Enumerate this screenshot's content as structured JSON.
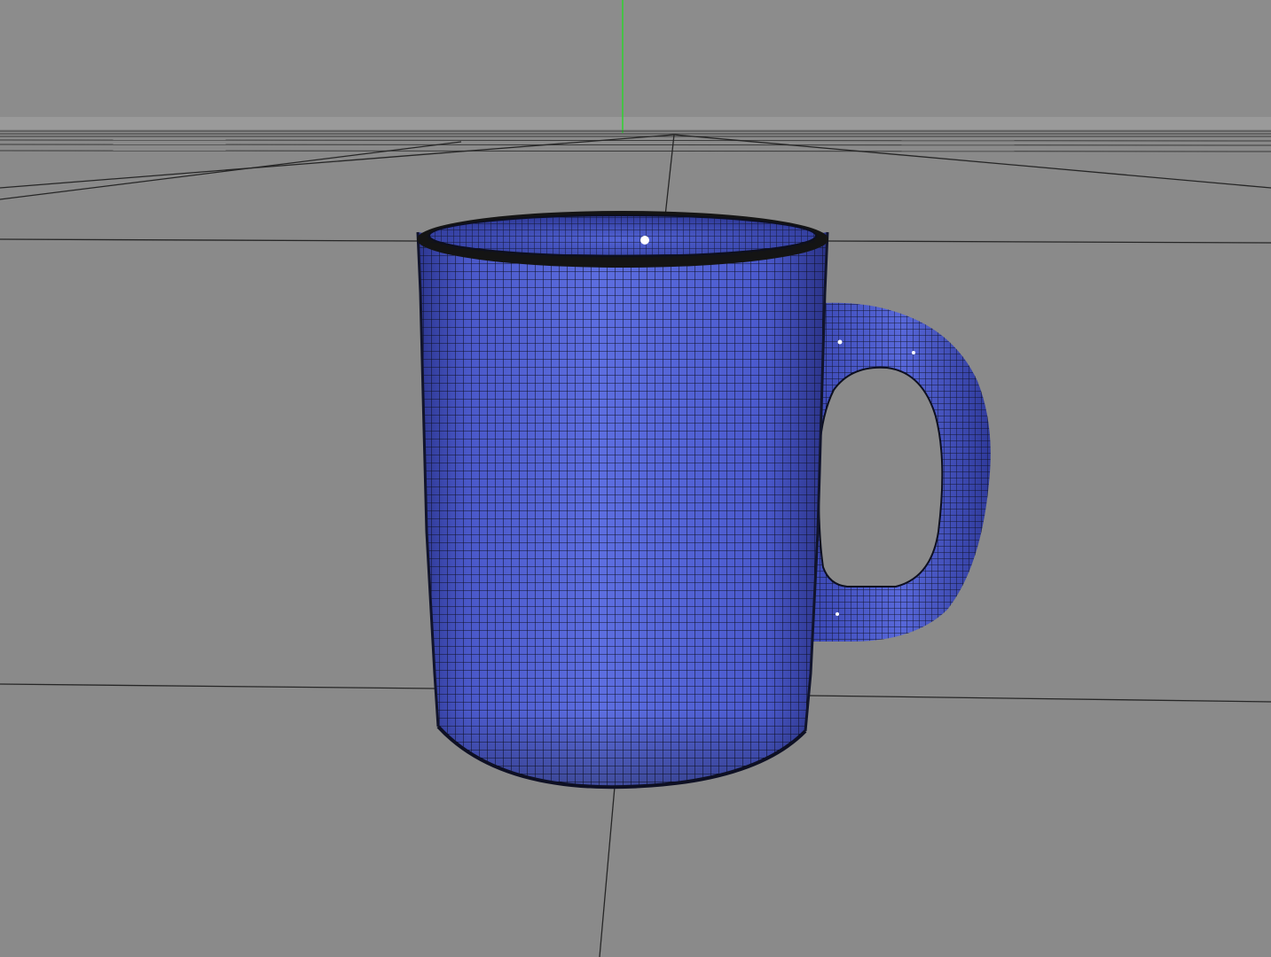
{
  "viewport": {
    "background_color": "#8a8a8a",
    "sky_color": "#8c8c8c",
    "horizon_band_color": "#9a9a9a",
    "grid_line_color": "#262626",
    "axis_y_color": "#2fd32f",
    "object": {
      "name": "mug",
      "surface_color": "#5566d8",
      "surface_dark_color": "#2b3594",
      "wire_color": "#0d0f20",
      "rim_color": "#141414",
      "highlight_color": "#ffffff"
    },
    "display_mode": "wireframe-on-shaded"
  }
}
